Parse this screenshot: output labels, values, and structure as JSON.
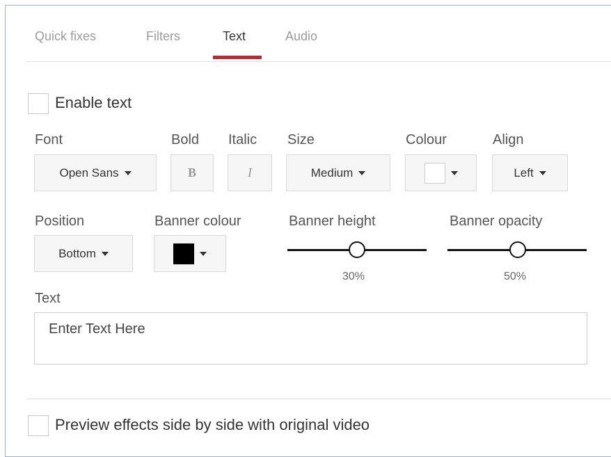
{
  "tabs": [
    {
      "label": "Quick fixes",
      "active": false
    },
    {
      "label": "Filters",
      "active": false
    },
    {
      "label": "Text",
      "active": true
    },
    {
      "label": "Audio",
      "active": false
    }
  ],
  "enable_text": {
    "label": "Enable text",
    "checked": false
  },
  "controls": {
    "font": {
      "label": "Font",
      "value": "Open Sans"
    },
    "bold": {
      "label": "Bold",
      "glyph": "B"
    },
    "italic": {
      "label": "Italic",
      "glyph": "I"
    },
    "size": {
      "label": "Size",
      "value": "Medium"
    },
    "colour": {
      "label": "Colour",
      "value": "#ffffff"
    },
    "align": {
      "label": "Align",
      "value": "Left"
    },
    "position": {
      "label": "Position",
      "value": "Bottom"
    },
    "banner_colour": {
      "label": "Banner colour",
      "value": "#000000"
    },
    "banner_height": {
      "label": "Banner height",
      "value": "30%"
    },
    "banner_opacity": {
      "label": "Banner opacity",
      "value": "50%"
    }
  },
  "text": {
    "label": "Text",
    "placeholder": "Enter Text Here"
  },
  "preview": {
    "label": "Preview effects side by side with original video",
    "checked": false
  },
  "colors": {
    "accent": "#c1272d",
    "frame_border": "#8fb3db"
  }
}
